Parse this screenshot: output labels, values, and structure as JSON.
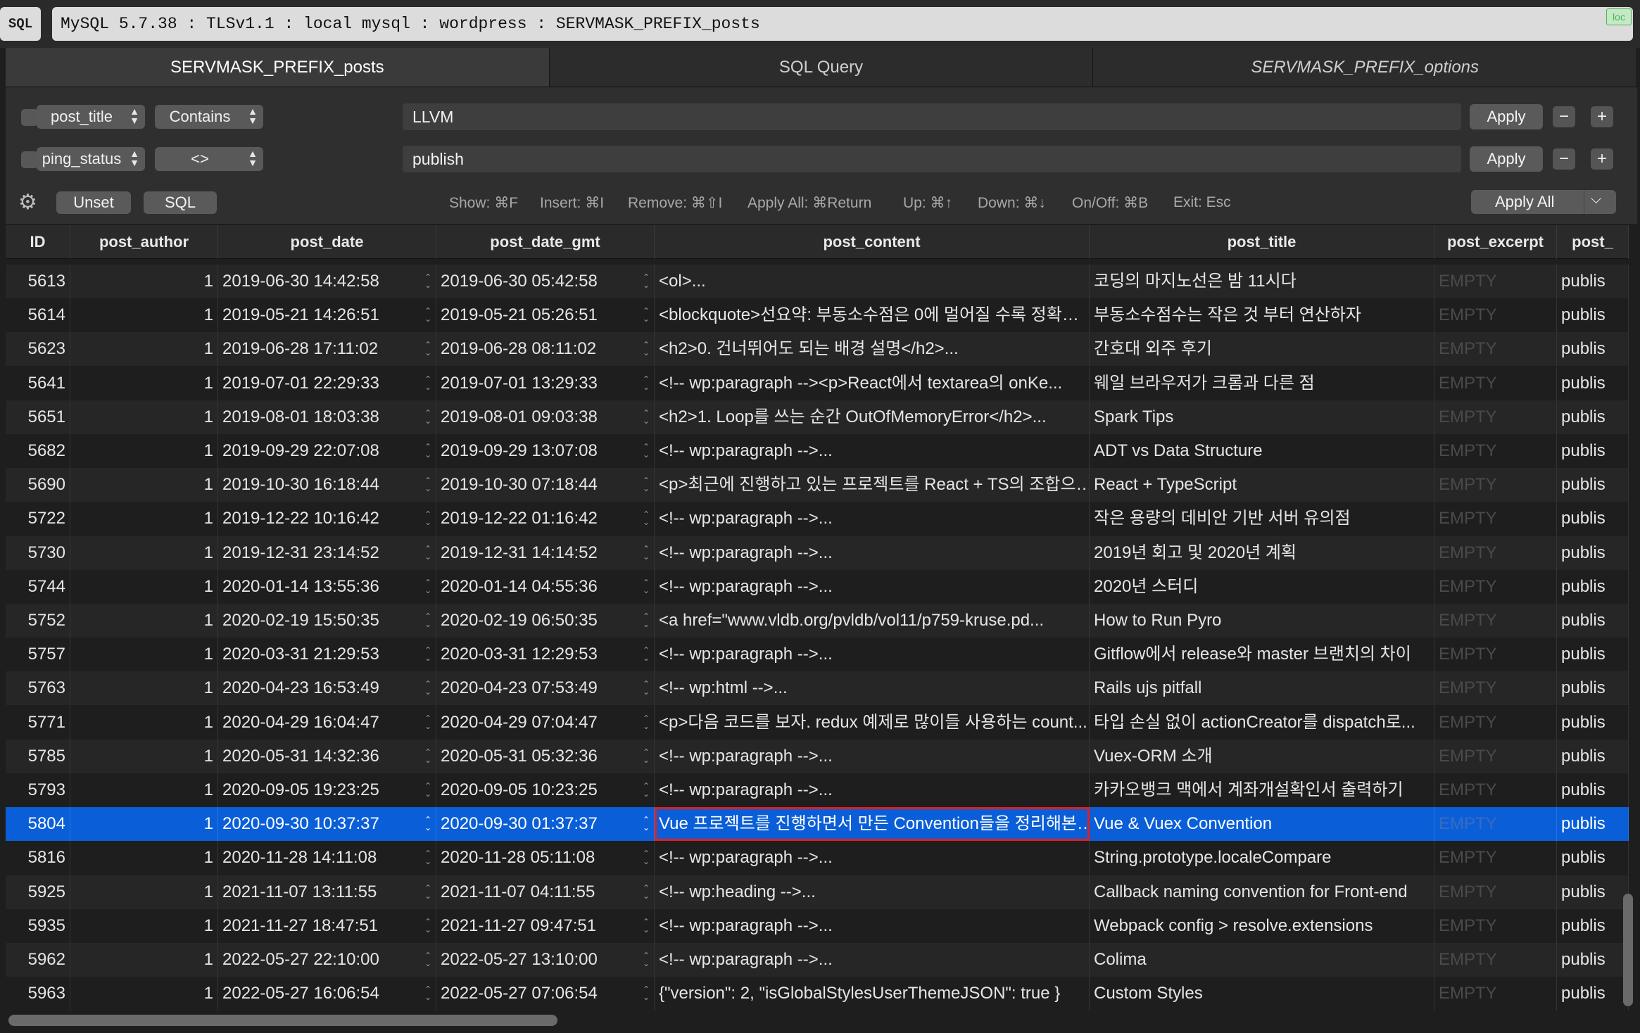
{
  "titlebar": {
    "sql_badge": "SQL",
    "connection": "MySQL 5.7.38 : TLSv1.1 : local mysql : wordpress : SERVMASK_PREFIX_posts",
    "loc_badge": "loc"
  },
  "tabs": [
    {
      "label": "SERVMASK_PREFIX_posts"
    },
    {
      "label": "SQL Query"
    },
    {
      "label": "SERVMASK_PREFIX_options"
    }
  ],
  "filters": [
    {
      "column": "post_title",
      "operator": "Contains",
      "value": "LLVM",
      "apply": "Apply",
      "remove": "−",
      "add": "+"
    },
    {
      "column": "ping_status",
      "operator": "<>",
      "value": "publish",
      "apply": "Apply",
      "remove": "−",
      "add": "+"
    }
  ],
  "toolbar": {
    "gear": "⚙",
    "unset": "Unset",
    "sql": "SQL",
    "hints": [
      "Show: ⌘F",
      "Insert: ⌘I",
      "Remove: ⌘⇧I",
      "Apply All: ⌘Return",
      "Up: ⌘↑",
      "Down: ⌘↓",
      "On/Off: ⌘B",
      "Exit: Esc"
    ],
    "apply_all": "Apply All",
    "apply_all_chevron": "⌵"
  },
  "table": {
    "columns": [
      "ID",
      "post_author",
      "post_date",
      "post_date_gmt",
      "post_content",
      "post_title",
      "post_excerpt",
      "post_"
    ],
    "selected_row_index": 16,
    "rows": [
      [
        "5613",
        "1",
        "2019-06-30 14:42:58",
        "2019-06-30 05:42:58",
        "<ol>...",
        "코딩의 마지노선은 밤 11시다",
        "EMPTY",
        "publis"
      ],
      [
        "5614",
        "1",
        "2019-05-21 14:26:51",
        "2019-05-21 05:26:51",
        "<blockquote>선요약: 부동소수점은 0에 멀어질 수록 정확…",
        "부동소수점수는 작은 것 부터 연산하자",
        "EMPTY",
        "publis"
      ],
      [
        "5623",
        "1",
        "2019-06-28 17:11:02",
        "2019-06-28 08:11:02",
        "<h2>0. 건너뛰어도 되는 배경 설명</h2>...",
        "간호대 외주 후기",
        "EMPTY",
        "publis"
      ],
      [
        "5641",
        "1",
        "2019-07-01 22:29:33",
        "2019-07-01 13:29:33",
        "<!-- wp:paragraph --><p>React에서 textarea의 onKe...",
        "웨일 브라우저가 크롬과 다른 점",
        "EMPTY",
        "publis"
      ],
      [
        "5651",
        "1",
        "2019-08-01 18:03:38",
        "2019-08-01 09:03:38",
        "<h2>1. Loop를 쓰는 순간 OutOfMemoryError</h2>...",
        "Spark Tips",
        "EMPTY",
        "publis"
      ],
      [
        "5682",
        "1",
        "2019-09-29 22:07:08",
        "2019-09-29 13:07:08",
        "<!-- wp:paragraph -->...",
        "ADT vs Data Structure",
        "EMPTY",
        "publis"
      ],
      [
        "5690",
        "1",
        "2019-10-30 16:18:44",
        "2019-10-30 07:18:44",
        "<p>최근에 진행하고 있는 프로젝트를 React + TS의 조합으…",
        "React + TypeScript",
        "EMPTY",
        "publis"
      ],
      [
        "5722",
        "1",
        "2019-12-22 10:16:42",
        "2019-12-22 01:16:42",
        "<!-- wp:paragraph -->...",
        "작은 용량의 데비안 기반 서버 유의점",
        "EMPTY",
        "publis"
      ],
      [
        "5730",
        "1",
        "2019-12-31 23:14:52",
        "2019-12-31 14:14:52",
        "<!-- wp:paragraph -->...",
        "2019년 회고 및 2020년 계획",
        "EMPTY",
        "publis"
      ],
      [
        "5744",
        "1",
        "2020-01-14 13:55:36",
        "2020-01-14 04:55:36",
        "<!-- wp:paragraph -->...",
        "2020년 스터디",
        "EMPTY",
        "publis"
      ],
      [
        "5752",
        "1",
        "2020-02-19 15:50:35",
        "2020-02-19 06:50:35",
        "<a href=\"www.vldb.org/pvldb/vol11/p759-kruse.pd...",
        "How to Run Pyro",
        "EMPTY",
        "publis"
      ],
      [
        "5757",
        "1",
        "2020-03-31 21:29:53",
        "2020-03-31 12:29:53",
        "<!-- wp:paragraph -->...",
        "Gitflow에서 release와 master 브랜치의 차이",
        "EMPTY",
        "publis"
      ],
      [
        "5763",
        "1",
        "2020-04-23 16:53:49",
        "2020-04-23 07:53:49",
        "<!-- wp:html -->...",
        "Rails ujs pitfall",
        "EMPTY",
        "publis"
      ],
      [
        "5771",
        "1",
        "2020-04-29 16:04:47",
        "2020-04-29 07:04:47",
        "<p>다음 코드를 보자. redux 예제로 많이들 사용하는 count...",
        "타입 손실 없이 actionCreator를 dispatch로...",
        "EMPTY",
        "publis"
      ],
      [
        "5785",
        "1",
        "2020-05-31 14:32:36",
        "2020-05-31 05:32:36",
        "<!-- wp:paragraph -->...",
        "Vuex-ORM 소개",
        "EMPTY",
        "publis"
      ],
      [
        "5793",
        "1",
        "2020-09-05 19:23:25",
        "2020-09-05 10:23:25",
        "<!-- wp:paragraph -->...",
        "카카오뱅크 맥에서 계좌개설확인서 출력하기",
        "EMPTY",
        "publis"
      ],
      [
        "5804",
        "1",
        "2020-09-30 10:37:37",
        "2020-09-30 01:37:37",
        "Vue 프로젝트를 진행하면서 만든 Convention들을 정리해본…",
        "Vue & Vuex Convention",
        "EMPTY",
        "publis"
      ],
      [
        "5816",
        "1",
        "2020-11-28 14:11:08",
        "2020-11-28 05:11:08",
        "<!-- wp:paragraph -->...",
        "String.prototype.localeCompare",
        "EMPTY",
        "publis"
      ],
      [
        "5925",
        "1",
        "2021-11-07 13:11:55",
        "2021-11-07 04:11:55",
        "<!-- wp:heading -->...",
        "Callback naming convention for Front-end",
        "EMPTY",
        "publis"
      ],
      [
        "5935",
        "1",
        "2021-11-27 18:47:51",
        "2021-11-27 09:47:51",
        "<!-- wp:paragraph -->...",
        "Webpack config > resolve.extensions",
        "EMPTY",
        "publis"
      ],
      [
        "5962",
        "1",
        "2022-05-27 22:10:00",
        "2022-05-27 13:10:00",
        "<!-- wp:paragraph -->...",
        "Colima",
        "EMPTY",
        "publis"
      ],
      [
        "5963",
        "1",
        "2022-05-27 16:06:54",
        "2022-05-27 07:06:54",
        "{\"version\": 2, \"isGlobalStylesUserThemeJSON\": true }",
        "Custom Styles",
        "EMPTY",
        "publis"
      ]
    ]
  },
  "colors": {
    "selection": "#0a5fd8",
    "focus_outline": "#e02020",
    "loc_green": "#3bbf4e"
  }
}
